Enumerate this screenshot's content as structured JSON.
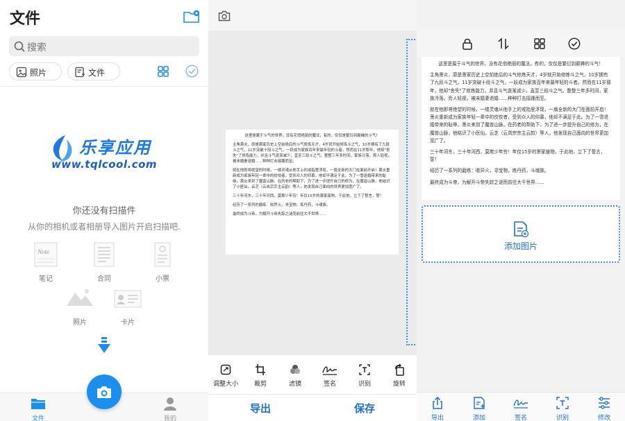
{
  "left_panel": {
    "title": "文件",
    "search_placeholder": "搜索",
    "filters": [
      {
        "label": "照片"
      },
      {
        "label": "文件"
      }
    ],
    "logo": {
      "name": "乐享应用",
      "url": "www.tqlcool.com"
    },
    "empty_title": "你还没有扫描件",
    "empty_subtitle": "从你的相机或者相册导入图片开启扫描吧.",
    "categories": [
      {
        "label": "笔记",
        "icon": "note-icon",
        "icon_text": "Note"
      },
      {
        "label": "合同",
        "icon": "contract-icon"
      },
      {
        "label": "小票",
        "icon": "receipt-icon"
      },
      {
        "label": "照片",
        "icon": "photo-icon"
      },
      {
        "label": "卡片",
        "icon": "card-icon"
      }
    ],
    "bottom_tabs": [
      {
        "label": "文件",
        "active": true
      },
      {
        "label": "我的",
        "active": false
      }
    ]
  },
  "document_text": [
    "这里是属于斗气的世界，没有花俏艳丽的魔法，有的，仅仅是繁衍到巅峰的斗气！",
    "主角萧炎，原是萧家历史上空前绝后的斗气修炼天才，4岁就开始修炼斗之气，10岁拥有了九段斗之气，11岁突破十段斗之气，一跃成为家族百年来最年轻的斗者。然而在11岁那年，他却\"丧失\"了修炼能力，并且斗气逐渐减少，直至三段斗之气。整整三年多时间，家族冷落，旁人轻视，被未婚妻退婚……种种打击接踵而至。",
    "就在他即将绝望的时候，一缕灵魂从他手上的戒指里浮现，一扇全新的大门在面前开启！萧炎重新成为家族年轻一辈中的佼佼者，受到众人的仰慕，他却不满足于此。为了一雪退婚带来的耻辱，萧炎来到了魔兽山脉。在药老的帮助下，为了进一步提升自己的修为，在魔兽山脉，他结识了小医仙，云芝（云岚宗宗主云韵）等人，他发现自己面向的世界更加宽广了。",
    "三十年河东，三十年河西，莫欺少年穷！年仅15岁的萧家废物，于此地，立下了誓言，誓！",
    "经历了一系列的磨练：收异火，寻宝物，炼丹药，斗魂族。",
    "最终成为斗帝，为解开斗帝失踪之谜而前往大千世界……"
  ],
  "edit_panel": {
    "tools": [
      {
        "label": "调整大小",
        "icon": "resize-icon"
      },
      {
        "label": "裁剪",
        "icon": "crop-icon"
      },
      {
        "label": "滤镜",
        "icon": "filter-icon"
      },
      {
        "label": "签名",
        "icon": "signature-icon"
      },
      {
        "label": "识别",
        "icon": "recognize-icon"
      },
      {
        "label": "旋转",
        "icon": "rotate-icon"
      }
    ],
    "actions": {
      "export": "导出",
      "save": "保存"
    }
  },
  "preview_panel": {
    "top_icons": [
      "lock-icon",
      "sort-icon",
      "grid-icon",
      "check-circle-icon"
    ],
    "add_image_label": "添加图片",
    "bottom_tabs": [
      {
        "label": "导出",
        "icon": "export-icon"
      },
      {
        "label": "添加",
        "icon": "add-icon"
      },
      {
        "label": "签名",
        "icon": "signature-icon"
      },
      {
        "label": "识别",
        "icon": "recognize-icon"
      },
      {
        "label": "修改",
        "icon": "adjust-icon"
      }
    ]
  },
  "colors": {
    "accent": "#1f6fd8",
    "fab": "#1a8ff0",
    "tab_active": "#1a8ff0",
    "tab_inactive": "#999999"
  }
}
